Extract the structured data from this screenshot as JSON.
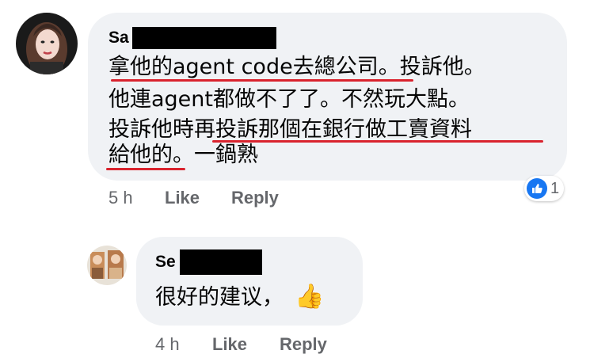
{
  "comment": {
    "author_visible": "Sa",
    "lines": [
      "拿他的agent code去總公司。投訴他。",
      "他連agent都做不了了。不然玩大點。",
      "投訴他時再投訴那個在銀行做工賣資料",
      "給他的。一鍋熟"
    ],
    "time": "5 h",
    "like_label": "Like",
    "reply_label": "Reply",
    "reaction_count": "1",
    "reaction_icon": "thumbs-up-icon",
    "underline_color": "#d9232e"
  },
  "reply": {
    "author_visible": "Se",
    "text": "很好的建议，",
    "emoji": "👍",
    "time": "4 h",
    "like_label": "Like",
    "reply_label": "Reply"
  },
  "colors": {
    "bubble": "#f0f2f5",
    "meta_text": "#65676b",
    "like_blue": "#1877f2"
  }
}
